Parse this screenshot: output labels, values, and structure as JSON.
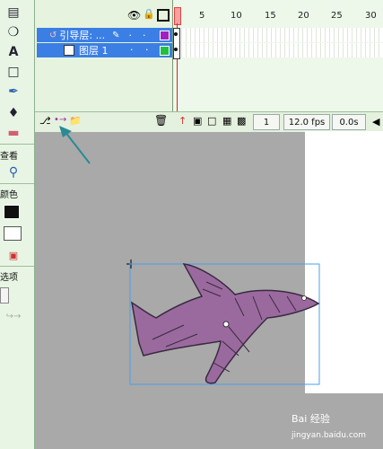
{
  "tools": {
    "section_view": "查看",
    "section_colors": "颜色",
    "section_options": "选项"
  },
  "timeline": {
    "layers": [
      {
        "name": "引导层: ...",
        "selected": true
      },
      {
        "name": "图层 1",
        "selected": true
      }
    ],
    "ruler": [
      "5",
      "10",
      "15",
      "20",
      "25",
      "30"
    ],
    "frame_number": "1",
    "fps": "12.0 fps",
    "time": "0.0s"
  },
  "colors": {
    "selection_blue": "#3b7fe5",
    "panel_green": "#e6f3df",
    "stage_gray": "#a9a9a9",
    "shape_purple": "#9a6a9e",
    "arrow_teal": "#2a8a94"
  },
  "watermark": {
    "text": "Bai 经验",
    "url": "jingyan.baidu.com"
  }
}
